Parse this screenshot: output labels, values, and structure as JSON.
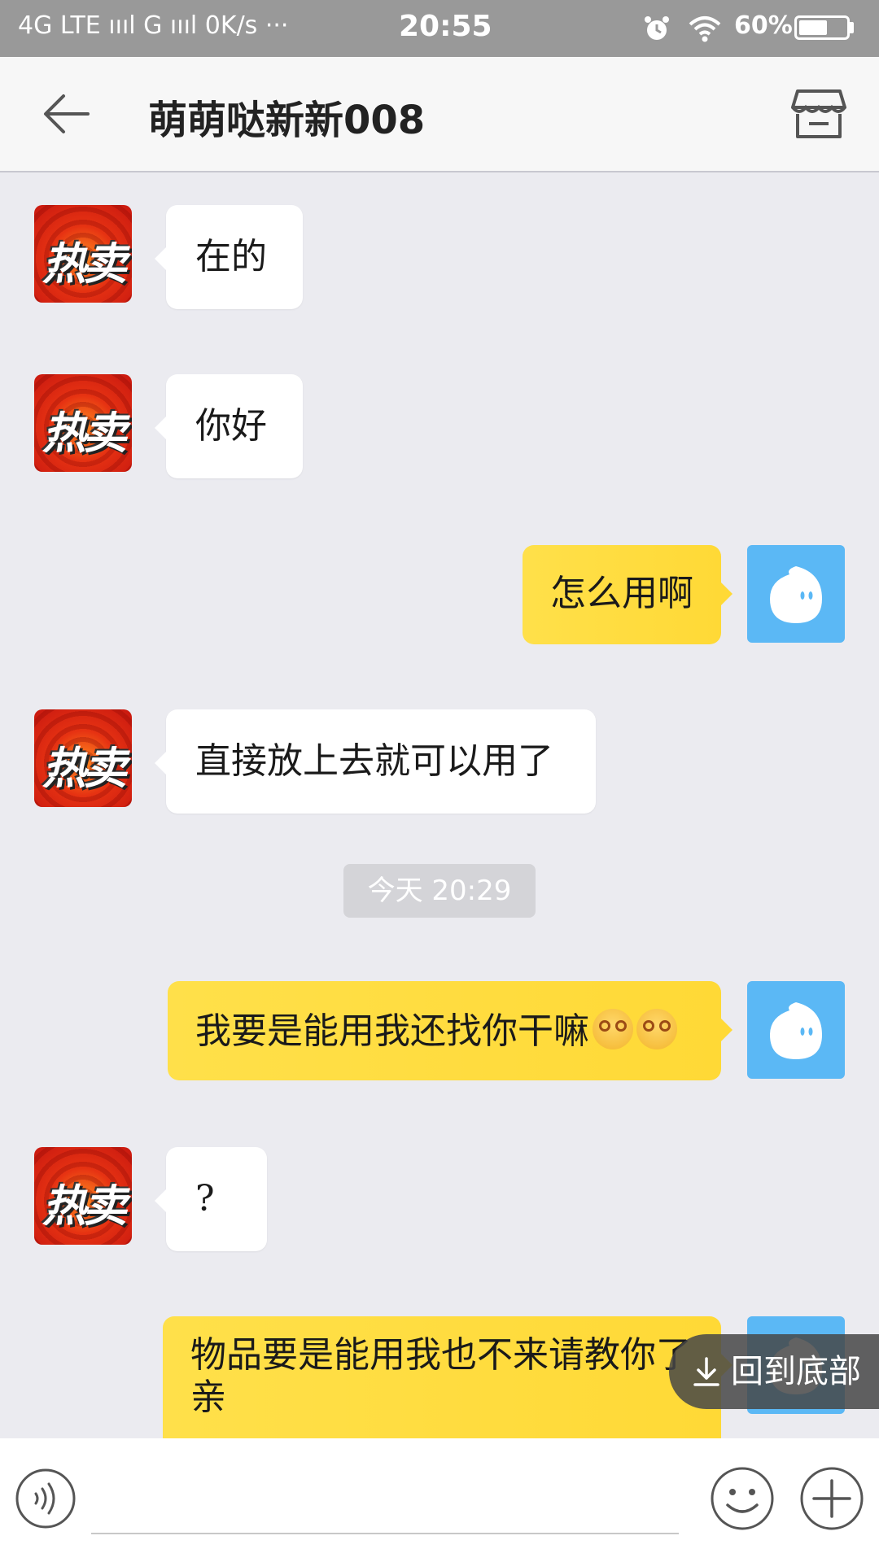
{
  "status_bar": {
    "network": "4G LTE ıııl G ıııl 0K/s ···",
    "time": "20:55",
    "battery": "60%",
    "battery_level": 0.6
  },
  "header": {
    "title": "萌萌哒新新008"
  },
  "messages": [
    {
      "side": "left",
      "text": "在的",
      "avatar_text": "热卖"
    },
    {
      "side": "left",
      "text": "你好",
      "avatar_text": "热卖"
    },
    {
      "side": "right",
      "text": "怎么用啊"
    },
    {
      "side": "left",
      "text": "直接放上去就可以用了",
      "avatar_text": "热卖"
    },
    {
      "side": "right",
      "text": "我要是能用我还找你干嘛",
      "emoji": "dizzy-face-emoji x2"
    },
    {
      "side": "left",
      "text": "?",
      "avatar_text": "热卖"
    },
    {
      "side": "right",
      "text": "物品要是能用我也不来请教你了亲"
    }
  ],
  "timestamp": "今天 20:29",
  "scroll_to_bottom": "回到底部",
  "colors": {
    "right_bubble": "#ffd936",
    "left_bubble": "#ffffff",
    "self_avatar": "#5bb8f5",
    "background": "#ebebf0"
  }
}
